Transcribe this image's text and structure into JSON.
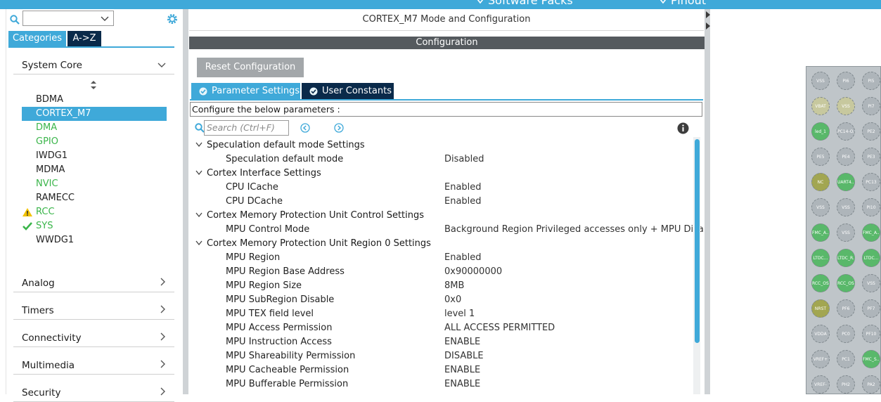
{
  "top_bar": {
    "left_text": "Software Packs",
    "right_text": "Pinout"
  },
  "left_panel": {
    "tabs": [
      "Categories",
      "A->Z"
    ],
    "categories_expanded": {
      "label": "System Core"
    },
    "system_core_items": [
      {
        "label": "BDMA",
        "style": "normal",
        "status": ""
      },
      {
        "label": "CORTEX_M7",
        "style": "selected",
        "status": ""
      },
      {
        "label": "DMA",
        "style": "green",
        "status": ""
      },
      {
        "label": "GPIO",
        "style": "green",
        "status": ""
      },
      {
        "label": "IWDG1",
        "style": "normal",
        "status": ""
      },
      {
        "label": "MDMA",
        "style": "normal",
        "status": ""
      },
      {
        "label": "NVIC",
        "style": "green",
        "status": ""
      },
      {
        "label": "RAMECC",
        "style": "normal",
        "status": ""
      },
      {
        "label": "RCC",
        "style": "green",
        "status": "warning-icon"
      },
      {
        "label": "SYS",
        "style": "green",
        "status": "check-icon"
      },
      {
        "label": "WWDG1",
        "style": "normal",
        "status": ""
      }
    ],
    "other_categories": [
      "Analog",
      "Timers",
      "Connectivity",
      "Multimedia",
      "Security"
    ]
  },
  "center": {
    "title": "CORTEX_M7 Mode and Configuration",
    "config_header": "Configuration",
    "reset_button": "Reset Configuration",
    "tabs": [
      "Parameter Settings",
      "User Constants"
    ],
    "configure_label": "Configure the below parameters :",
    "search_placeholder": "Search (Ctrl+F)",
    "groups": [
      {
        "title": "Speculation default mode Settings",
        "params": [
          {
            "name": "Speculation default mode",
            "value": "Disabled"
          }
        ]
      },
      {
        "title": "Cortex Interface Settings",
        "params": [
          {
            "name": "CPU ICache",
            "value": "Enabled"
          },
          {
            "name": "CPU DCache",
            "value": "Enabled"
          }
        ]
      },
      {
        "title": "Cortex Memory Protection Unit Control Settings",
        "params": [
          {
            "name": "MPU Control Mode",
            "value": "Background Region Privileged accesses only + MPU Disa..."
          }
        ]
      },
      {
        "title": "Cortex Memory Protection Unit Region 0 Settings",
        "params": [
          {
            "name": "MPU Region",
            "value": "Enabled"
          },
          {
            "name": "MPU Region Base Address",
            "value": "0x90000000"
          },
          {
            "name": "MPU Region Size",
            "value": "8MB"
          },
          {
            "name": "MPU SubRegion Disable",
            "value": "0x0"
          },
          {
            "name": "MPU TEX field level",
            "value": "level 1"
          },
          {
            "name": "MPU Access Permission",
            "value": "ALL ACCESS PERMITTED"
          },
          {
            "name": "MPU Instruction Access",
            "value": "ENABLE"
          },
          {
            "name": "MPU Shareability Permission",
            "value": "DISABLE"
          },
          {
            "name": "MPU Cacheable Permission",
            "value": "ENABLE"
          },
          {
            "name": "MPU Bufferable  Permission",
            "value": "ENABLE"
          }
        ]
      }
    ]
  },
  "chip": {
    "pins": [
      [
        "VSS",
        "PI6",
        "PI5"
      ],
      [
        "VBAT",
        "VSS",
        "PI7"
      ],
      [
        "led_1",
        "PC14-O...",
        "PE2"
      ],
      [
        "PE5",
        "PE4",
        "PE3"
      ],
      [
        "NC",
        "UART4...",
        "PC13"
      ],
      [
        "VSS",
        "VSS",
        "PI10"
      ],
      [
        "FMC_A...",
        "VSS",
        "FMC_A..."
      ],
      [
        "LTDC...",
        "LTDC_R...",
        "LTDC..."
      ],
      [
        "RCC_OS...",
        "RCC_OS...",
        "VSS"
      ],
      [
        "NRST",
        "PF6",
        "PF7"
      ],
      [
        "VDDA",
        "PC0",
        "PF10"
      ],
      [
        "VREF+",
        "PC1",
        "FMC_S..."
      ],
      [
        "VREF-",
        "PH2",
        "PA2"
      ]
    ],
    "pin_colors": [
      [
        "grey",
        "grey",
        "grey"
      ],
      [
        "yellow",
        "yellow",
        "grey"
      ],
      [
        "green",
        "grey",
        "grey"
      ],
      [
        "grey",
        "grey",
        "grey"
      ],
      [
        "olive",
        "green",
        "grey"
      ],
      [
        "grey",
        "grey",
        "grey"
      ],
      [
        "green",
        "grey",
        "green"
      ],
      [
        "green",
        "green",
        "green"
      ],
      [
        "green",
        "green",
        "grey"
      ],
      [
        "olive",
        "grey",
        "grey"
      ],
      [
        "grey",
        "grey",
        "grey"
      ],
      [
        "grey",
        "grey",
        "green"
      ],
      [
        "grey",
        "grey",
        "grey"
      ]
    ]
  },
  "colors": {
    "accent": "#3fa9d9",
    "dark_tab": "#0a2a4a",
    "header_bar": "#555a5e",
    "green_text": "#3ab54a",
    "warning": "#f2c200"
  }
}
